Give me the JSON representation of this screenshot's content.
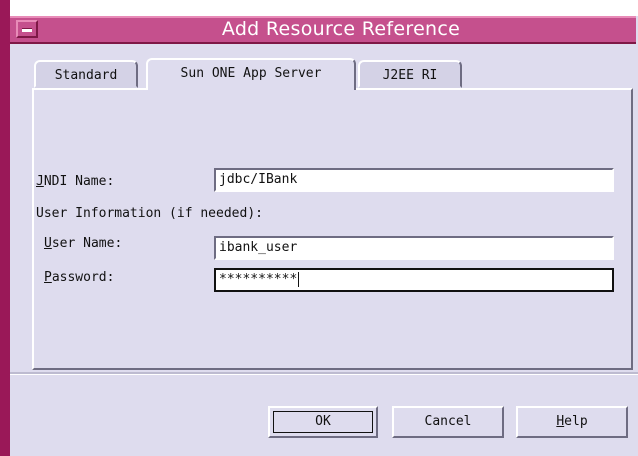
{
  "window": {
    "title": "Add Resource Reference"
  },
  "tabs": [
    {
      "label": "Standard",
      "active": false
    },
    {
      "label": "Sun ONE App Server",
      "active": true
    },
    {
      "label": "J2EE RI",
      "active": false
    }
  ],
  "form": {
    "jndi_label_mnemonic": "J",
    "jndi_label_rest": "NDI Name:",
    "jndi_value": "jdbc/IBank",
    "user_info_heading": "User Information (if needed):",
    "username_label_mnemonic": "U",
    "username_label_rest": "ser Name:",
    "username_value": "ibank_user",
    "password_label_mnemonic": "P",
    "password_label_rest": "assword:",
    "password_value": "**********"
  },
  "buttons": {
    "ok": "OK",
    "cancel": "Cancel",
    "help_mnemonic": "H",
    "help_rest": "elp"
  },
  "colors": {
    "titlebar": "#c5508d",
    "frame": "#9a1858",
    "dialog_bg": "#dedcee"
  }
}
